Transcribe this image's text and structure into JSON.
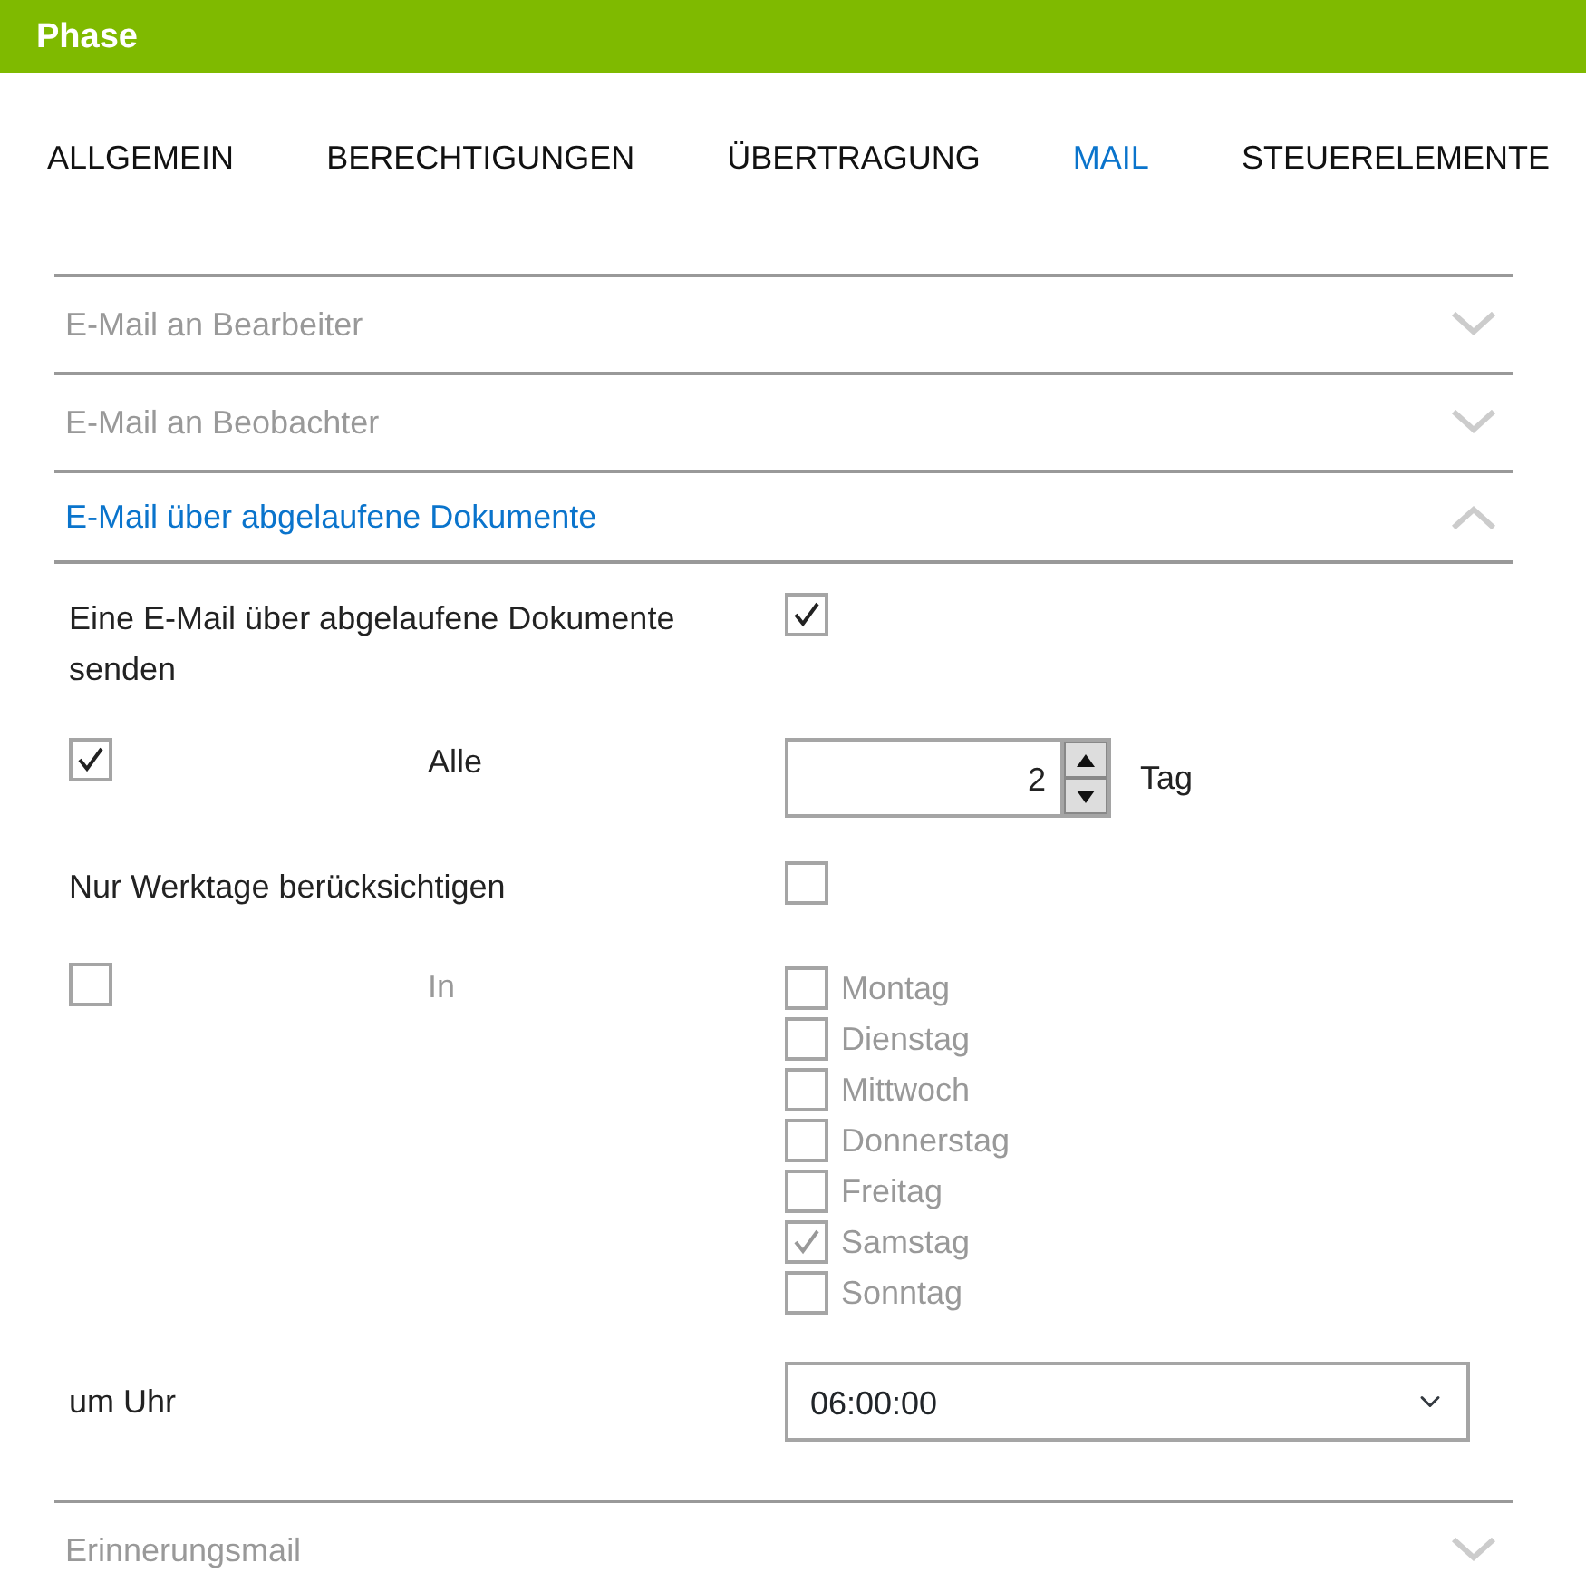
{
  "window": {
    "title": "Phase"
  },
  "tabs": [
    {
      "label": "ALLGEMEIN",
      "selected": false
    },
    {
      "label": "BERECHTIGUNGEN",
      "selected": false
    },
    {
      "label": "ÜBERTRAGUNG",
      "selected": false
    },
    {
      "label": "MAIL",
      "selected": true
    },
    {
      "label": "STEUERELEMENTE",
      "selected": false
    }
  ],
  "sections": [
    {
      "title": "E-Mail an Bearbeiter",
      "expanded": false
    },
    {
      "title": "E-Mail an Beobachter",
      "expanded": false
    },
    {
      "title": "E-Mail über abgelaufene Dokumente",
      "expanded": true,
      "fields": [
        {
          "kind": "check",
          "label": "Eine E-Mail über abgelaufene Dokumente senden",
          "checked": true
        },
        {
          "kind": "interval",
          "checked": true,
          "label": "Alle",
          "value": "2",
          "unit": "Tag"
        },
        {
          "kind": "check",
          "label": "Nur Werktage berücksichtigen",
          "checked": false
        },
        {
          "kind": "days",
          "checked": false,
          "label": "In",
          "disabled": true,
          "days": [
            {
              "label": "Montag",
              "checked": false
            },
            {
              "label": "Dienstag",
              "checked": false
            },
            {
              "label": "Mittwoch",
              "checked": false
            },
            {
              "label": "Donnerstag",
              "checked": false
            },
            {
              "label": "Freitag",
              "checked": false
            },
            {
              "label": "Samstag",
              "checked": true
            },
            {
              "label": "Sonntag",
              "checked": false
            }
          ]
        },
        {
          "kind": "select",
          "label": "um Uhr",
          "value": "06:00:00"
        }
      ]
    },
    {
      "title": "Erinnerungsmail",
      "expanded": false
    }
  ]
}
